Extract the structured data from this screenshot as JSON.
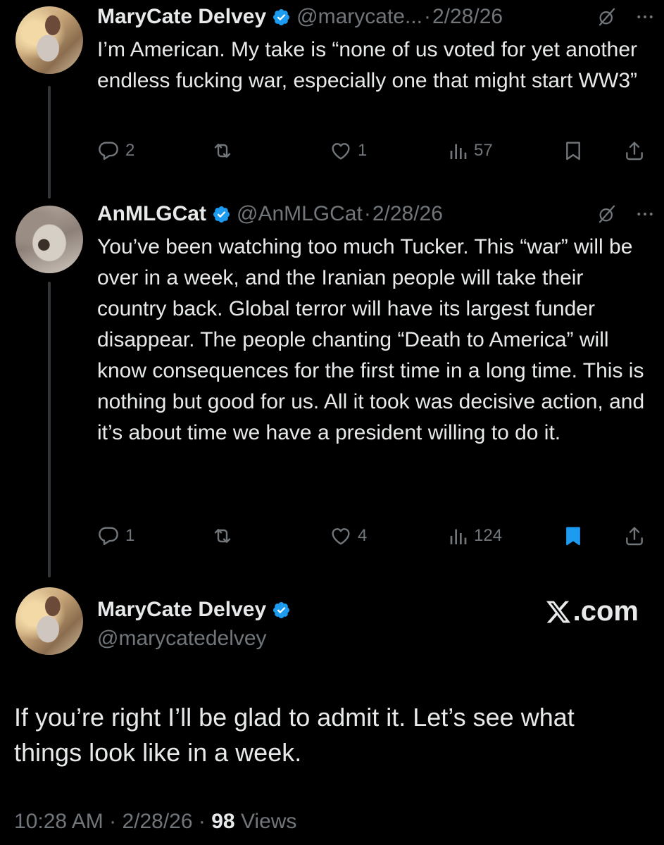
{
  "tweets": [
    {
      "name": "MaryCate Delvey",
      "handle": "@marycate...",
      "date": "2/28/26",
      "text": "I’m American. My take is “none of us voted for yet another endless fucking war, especially one that might start WW3”",
      "replies": "2",
      "reposts": "",
      "likes": "1",
      "views": "57",
      "bookmarked": false
    },
    {
      "name": "AnMLGCat",
      "handle": "@AnMLGCat",
      "date": "2/28/26",
      "text": "You’ve been watching too much Tucker. This “war” will be over in a week, and the Iranian people will take their country back. Global terror will have its largest funder disappear. The people chanting “Death to America” will know consequences for the first time in a long time. This is nothing but good for us. All it took was decisive action, and it’s about time we have a president willing to do it.",
      "replies": "1",
      "reposts": "",
      "likes": "4",
      "views": "124",
      "bookmarked": true
    }
  ],
  "main_tweet": {
    "name": "MaryCate Delvey",
    "handle": "@marycatedelvey",
    "text": "If you’re right I’ll be glad to admit it. Let’s see what things look like in a week.",
    "time": "10:28 AM",
    "date": "2/28/26",
    "views_count": "98",
    "views_label": "Views"
  },
  "watermark": ".com",
  "dot": "·",
  "colors": {
    "background": "#000000",
    "text": "#e7e9ea",
    "secondary": "#71767b",
    "verified": "#1d9bf0",
    "bookmark_active": "#1d9bf0",
    "thread_line": "#333639"
  },
  "icons": {
    "verified": "verified-badge-icon",
    "grok": "grok-icon",
    "more": "more-icon",
    "reply": "reply-icon",
    "repost": "repost-icon",
    "like": "like-icon",
    "views": "views-icon",
    "bookmark": "bookmark-icon",
    "share": "share-icon",
    "x_logo": "x-logo-icon"
  }
}
